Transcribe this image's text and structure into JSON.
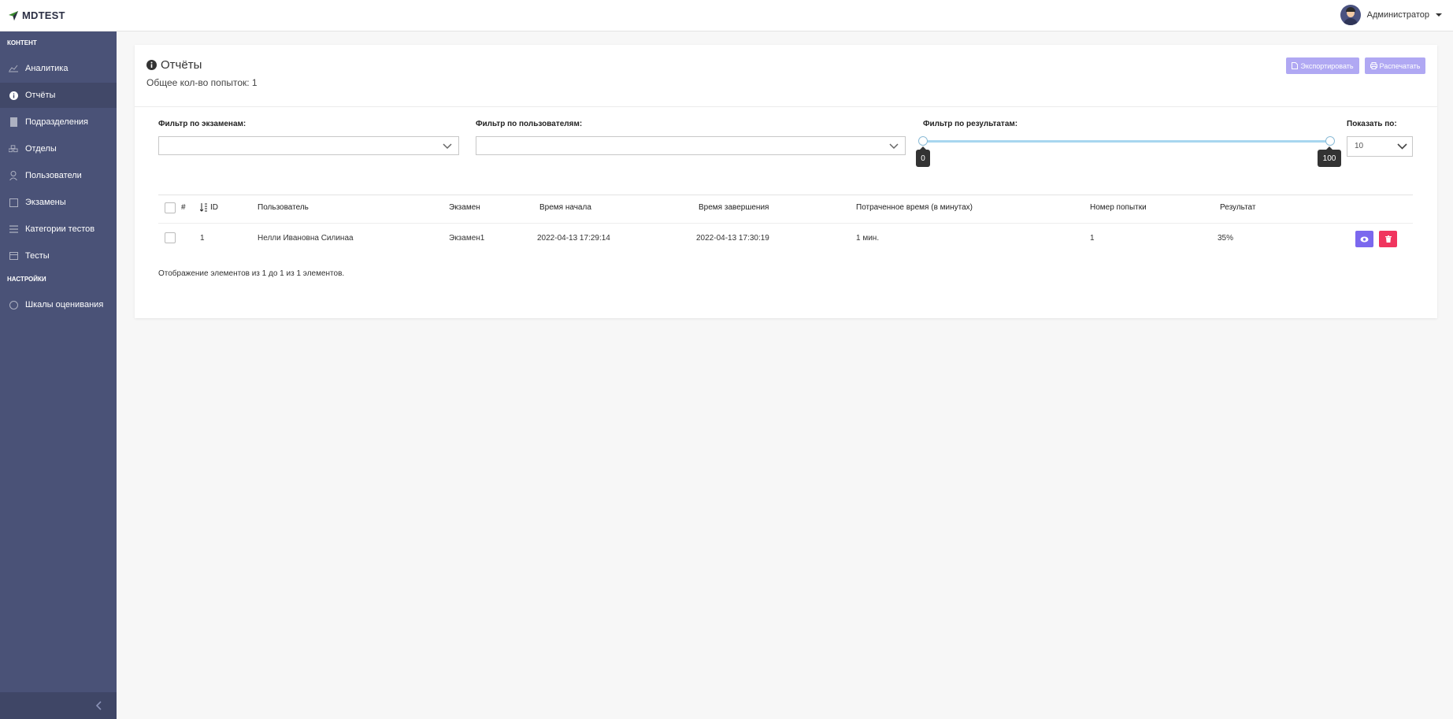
{
  "app": {
    "logo": "MDTEST"
  },
  "user": {
    "name": "Администратор"
  },
  "sidebar": {
    "sections": [
      "КОНТЕНТ",
      "НАСТРОЙКИ"
    ],
    "items": [
      {
        "label": "Аналитика",
        "icon": "chart-line-icon"
      },
      {
        "label": "Отчёты",
        "icon": "info-circle-icon",
        "active": true
      },
      {
        "label": "Подразделения",
        "icon": "building-icon"
      },
      {
        "label": "Отделы",
        "icon": "cubes-icon"
      },
      {
        "label": "Пользователи",
        "icon": "user-icon"
      },
      {
        "label": "Экзамены",
        "icon": "square-icon"
      },
      {
        "label": "Категории тестов",
        "icon": "list-icon"
      },
      {
        "label": "Тесты",
        "icon": "table-icon"
      },
      {
        "label": "Шкалы оценивания",
        "icon": "circle-icon"
      }
    ]
  },
  "page": {
    "title": "Отчёты",
    "subtitle": "Общее кол-во попыток: 1",
    "export_label": "Экспортировать",
    "print_label": "Распечатать"
  },
  "filters": {
    "exams_label": "Фильтр по экзаменам:",
    "users_label": "Фильтр по пользователям:",
    "results_label": "Фильтр по результатам:",
    "results_min": "0",
    "results_max": "100",
    "per_page_label": "Показать по:",
    "per_page_value": "10"
  },
  "table": {
    "headers": {
      "num": "#",
      "id": "ID",
      "user": "Пользователь",
      "exam": "Экзамен",
      "start": "Время начала",
      "end": "Время завершения",
      "spent": "Потраченное время (в минутах)",
      "attempt": "Номер попытки",
      "result": "Результат"
    },
    "rows": [
      {
        "id": "1",
        "user": "Нелли Ивановна Силинаа",
        "exam": "Экзамен1",
        "start": "2022-04-13 17:29:14",
        "end": "2022-04-13 17:30:19",
        "spent": "1 мин.",
        "attempt": "1",
        "result": "35%"
      }
    ],
    "footer": "Отображение элементов из 1 до 1 из 1 элементов."
  },
  "colors": {
    "sidebar": "#4a5277",
    "accent_purple": "#7b68ee",
    "danger": "#f0355e",
    "header_button": "#b0a8f3",
    "slider": "#a8d6ef"
  }
}
